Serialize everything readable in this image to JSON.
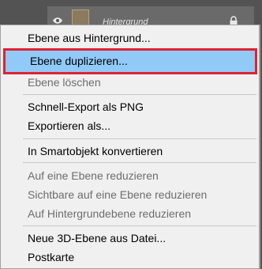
{
  "layers_panel": {
    "layer_name": "Hintergrund",
    "visibility_icon": "eye-icon",
    "lock_icon": "lock-icon"
  },
  "menu": {
    "items": [
      {
        "label": "Ebene aus Hintergrund...",
        "enabled": true
      },
      {
        "label": "Ebene duplizieren...",
        "enabled": true,
        "highlighted": true
      },
      {
        "label": "Ebene löschen",
        "enabled": false
      },
      {
        "label": "Schnell-Export als PNG",
        "enabled": true
      },
      {
        "label": "Exportieren als...",
        "enabled": true
      },
      {
        "label": "In Smartobjekt konvertieren",
        "enabled": true
      },
      {
        "label": "Auf eine Ebene reduzieren",
        "enabled": false
      },
      {
        "label": "Sichtbare auf eine Ebene reduzieren",
        "enabled": false
      },
      {
        "label": "Auf Hintergrundebene reduzieren",
        "enabled": false
      },
      {
        "label": "Neue 3D-Ebene aus Datei...",
        "enabled": true
      },
      {
        "label": "Postkarte",
        "enabled": true
      }
    ]
  },
  "colors": {
    "highlight_fill": "#91c9f7",
    "highlight_border": "#e02232",
    "menu_background": "#f0f0f0",
    "disabled_text": "#6d6d6d"
  }
}
